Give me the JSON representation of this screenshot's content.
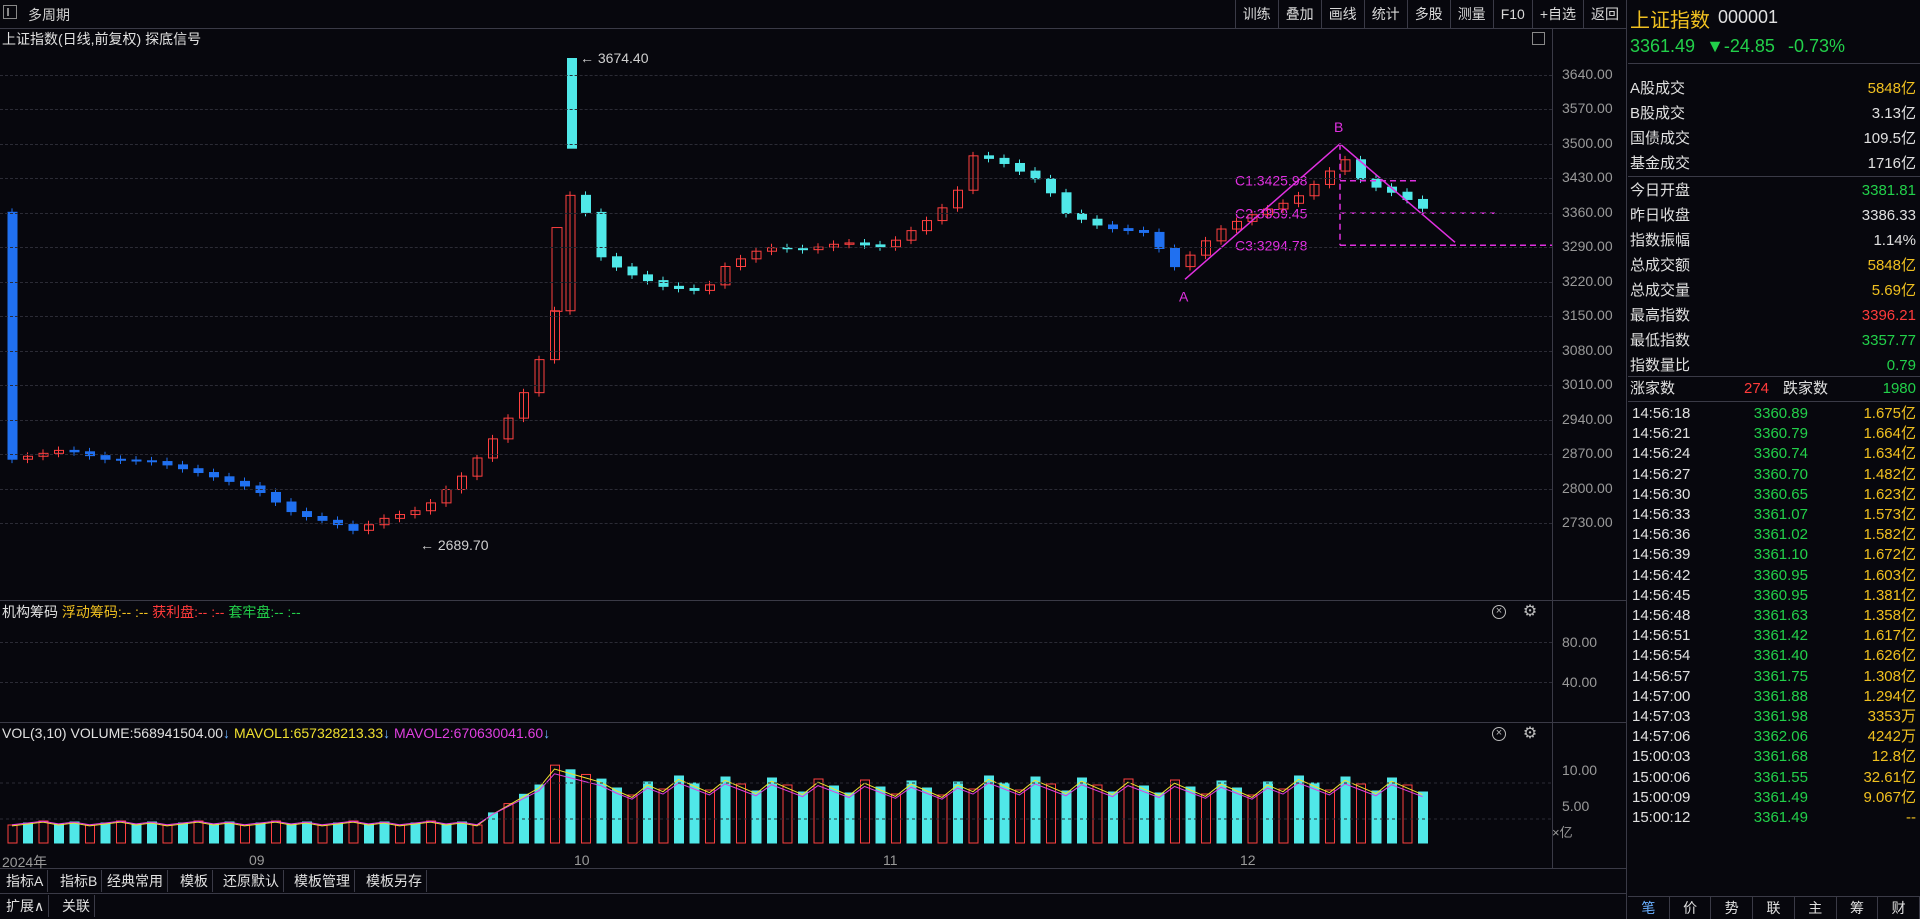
{
  "toolbar": {
    "multi_period": "多周期",
    "buttons": [
      "训练",
      "叠加",
      "画线",
      "统计",
      "多股",
      "测量",
      "F10",
      "+自选",
      "返回"
    ]
  },
  "chart": {
    "title": "上证指数(日线,前复权) 探底信号",
    "high_label": "3674.40",
    "low_label": "2689.70",
    "y_ticks": [
      "3640.00",
      "3570.00",
      "3500.00",
      "3430.00",
      "3360.00",
      "3290.00",
      "3220.00",
      "3150.00",
      "3080.00",
      "3010.00",
      "2940.00",
      "2870.00",
      "2800.00",
      "2730.00"
    ],
    "x_labels": [
      "2024年",
      "09",
      "10",
      "11",
      "12"
    ],
    "pattern": {
      "a": "A",
      "b": "B",
      "c1": "C1:3425.98",
      "c2": "C2:3359.45",
      "c3": "C3:3294.78"
    }
  },
  "chips": {
    "label": "机构筹码",
    "float": "浮动筹码:",
    "float_val": "-- :--",
    "profit": "获利盘:",
    "profit_val": "-- :--",
    "trapped": "套牢盘:",
    "trapped_val": "-- :--",
    "ticks": [
      "80.00",
      "40.00"
    ]
  },
  "volume": {
    "name": "VOL(3,10)",
    "volume": "VOLUME:568941504.00",
    "mavol1": "MAVOL1:657328213.33",
    "mavol2": "MAVOL2:670630041.60",
    "ticks": [
      "10.00",
      "5.00"
    ],
    "unit": "×亿"
  },
  "bottom_tabs": [
    "指标A",
    "指标B",
    "经典常用",
    "模板",
    "还原默认",
    "模板管理",
    "模板另存"
  ],
  "bottom_tabs2": [
    "扩展∧",
    "关联"
  ],
  "quote": {
    "name": "上证指数",
    "code": "000001",
    "price": "3361.49",
    "change": "▼-24.85",
    "pct": "-0.73%"
  },
  "stats": [
    {
      "label": "A股成交",
      "value": "5848亿",
      "color": "#f0c020"
    },
    {
      "label": "B股成交",
      "value": "3.13亿",
      "color": "#e0e0e0"
    },
    {
      "label": "国债成交",
      "value": "109.5亿",
      "color": "#e0e0e0"
    },
    {
      "label": "基金成交",
      "value": "1716亿",
      "color": "#e0e0e0"
    },
    {
      "label": "今日开盘",
      "value": "3381.81",
      "color": "#22d04a"
    },
    {
      "label": "昨日收盘",
      "value": "3386.33",
      "color": "#e0e0e0"
    },
    {
      "label": "指数振幅",
      "value": "1.14%",
      "color": "#e0e0e0"
    },
    {
      "label": "总成交额",
      "value": "5848亿",
      "color": "#f0c020"
    },
    {
      "label": "总成交量",
      "value": "5.69亿",
      "color": "#f0c020"
    },
    {
      "label": "最高指数",
      "value": "3396.21",
      "color": "#ff3b3b"
    },
    {
      "label": "最低指数",
      "value": "3357.77",
      "color": "#22d04a"
    },
    {
      "label": "指数量比",
      "value": "0.79",
      "color": "#22d04a"
    }
  ],
  "breadth": {
    "up_label": "涨家数",
    "up": "274",
    "down_label": "跌家数",
    "down": "1980"
  },
  "ticks": [
    {
      "t": "14:56:18",
      "p": "3360.89",
      "v": "1.675亿"
    },
    {
      "t": "14:56:21",
      "p": "3360.79",
      "v": "1.664亿"
    },
    {
      "t": "14:56:24",
      "p": "3360.74",
      "v": "1.634亿"
    },
    {
      "t": "14:56:27",
      "p": "3360.70",
      "v": "1.482亿"
    },
    {
      "t": "14:56:30",
      "p": "3360.65",
      "v": "1.623亿"
    },
    {
      "t": "14:56:33",
      "p": "3361.07",
      "v": "1.573亿"
    },
    {
      "t": "14:56:36",
      "p": "3361.02",
      "v": "1.582亿"
    },
    {
      "t": "14:56:39",
      "p": "3361.10",
      "v": "1.672亿"
    },
    {
      "t": "14:56:42",
      "p": "3360.95",
      "v": "1.603亿"
    },
    {
      "t": "14:56:45",
      "p": "3360.95",
      "v": "1.381亿"
    },
    {
      "t": "14:56:48",
      "p": "3361.63",
      "v": "1.358亿"
    },
    {
      "t": "14:56:51",
      "p": "3361.42",
      "v": "1.617亿"
    },
    {
      "t": "14:56:54",
      "p": "3361.40",
      "v": "1.626亿"
    },
    {
      "t": "14:56:57",
      "p": "3361.75",
      "v": "1.308亿"
    },
    {
      "t": "14:57:00",
      "p": "3361.88",
      "v": "1.294亿"
    },
    {
      "t": "14:57:03",
      "p": "3361.98",
      "v": "3353万"
    },
    {
      "t": "14:57:06",
      "p": "3362.06",
      "v": "4242万"
    },
    {
      "t": "15:00:03",
      "p": "3361.68",
      "v": "12.8亿"
    },
    {
      "t": "15:00:06",
      "p": "3361.55",
      "v": "32.61亿"
    },
    {
      "t": "15:00:09",
      "p": "3361.49",
      "v": "9.067亿"
    },
    {
      "t": "15:00:12",
      "p": "3361.49",
      "v": "--"
    }
  ],
  "rp_tabs": [
    "笔",
    "价",
    "势",
    "联",
    "主",
    "筹",
    "财"
  ]
}
